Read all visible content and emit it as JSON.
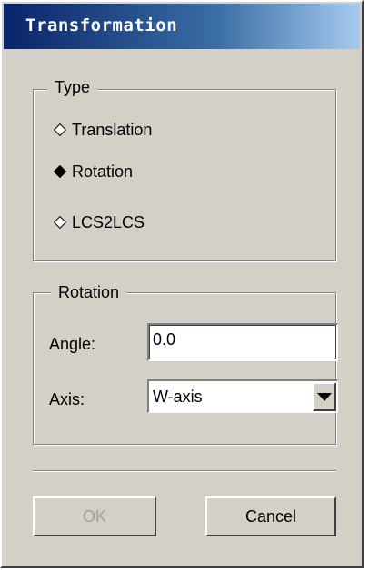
{
  "window": {
    "title": "Transformation"
  },
  "type_group": {
    "legend": "Type",
    "options": [
      {
        "label": "Translation",
        "checked": false
      },
      {
        "label": "Rotation",
        "checked": true
      },
      {
        "label": "LCS2LCS",
        "checked": false
      }
    ]
  },
  "rotation_group": {
    "legend": "Rotation",
    "angle_label": "Angle:",
    "angle_value": "0.0",
    "axis_label": "Axis:",
    "axis_value": "W-axis"
  },
  "buttons": {
    "ok": {
      "label": "OK",
      "enabled": false
    },
    "cancel": {
      "label": "Cancel",
      "enabled": true
    }
  }
}
